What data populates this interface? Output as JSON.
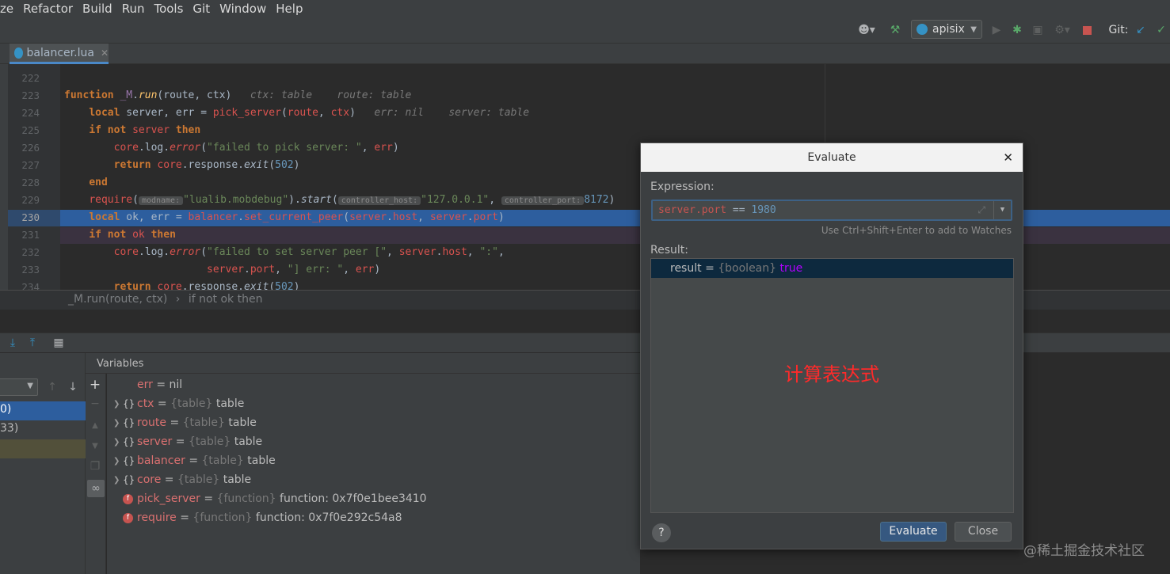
{
  "menu": [
    "ze",
    "Refactor",
    "Build",
    "Run",
    "Tools",
    "Git",
    "Window",
    "Help"
  ],
  "toolbar": {
    "run_config": "apisix",
    "git_label": "Git:"
  },
  "tab": {
    "file_name": "balancer.lua"
  },
  "editor": {
    "lines": [
      {
        "num": "222"
      },
      {
        "num": "223"
      },
      {
        "num": "224"
      },
      {
        "num": "225"
      },
      {
        "num": "226"
      },
      {
        "num": "227"
      },
      {
        "num": "228"
      },
      {
        "num": "229"
      },
      {
        "num": "230"
      },
      {
        "num": "231"
      },
      {
        "num": "232"
      },
      {
        "num": "233"
      },
      {
        "num": "234"
      }
    ],
    "hints": {
      "ctx": "ctx: table",
      "route": "route: table",
      "err": "err: nil",
      "server": "server: table",
      "modname": "modname:",
      "controller_host": "controller_host:",
      "controller_port": "controller_port:"
    },
    "highlighted_line": "230"
  },
  "breadcrumb": {
    "func": "_M.run(route, ctx)",
    "sep": "›",
    "block": "if not ok then"
  },
  "frames": {
    "items": [
      "0)",
      "33)"
    ]
  },
  "variables": {
    "title": "Variables",
    "items": [
      {
        "name": "err",
        "type": "",
        "value": "nil",
        "expandable": false,
        "kind": "plain"
      },
      {
        "name": "ctx",
        "type": "{table}",
        "value": "table",
        "expandable": true,
        "kind": "table"
      },
      {
        "name": "route",
        "type": "{table}",
        "value": "table",
        "expandable": true,
        "kind": "table"
      },
      {
        "name": "server",
        "type": "{table}",
        "value": "table",
        "expandable": true,
        "kind": "table"
      },
      {
        "name": "balancer",
        "type": "{table}",
        "value": "table",
        "expandable": true,
        "kind": "table"
      },
      {
        "name": "core",
        "type": "{table}",
        "value": "table",
        "expandable": true,
        "kind": "table"
      },
      {
        "name": "pick_server",
        "type": "{function}",
        "value": "function: 0x7f0e1bee3410",
        "expandable": false,
        "kind": "function"
      },
      {
        "name": "require",
        "type": "{function}",
        "value": "function: 0x7f0e292c54a8",
        "expandable": false,
        "kind": "function"
      }
    ]
  },
  "dialog": {
    "title": "Evaluate",
    "expression_label": "Expression:",
    "expression_lhs": "server.port",
    "expression_op": "==",
    "expression_rhs": "1980",
    "hint": "Use Ctrl+Shift+Enter to add to Watches",
    "result_label": "Result:",
    "result_name": "result",
    "result_eq": "=",
    "result_type": "{boolean}",
    "result_value": "true",
    "annotation": "计算表达式",
    "help": "?",
    "evaluate_button": "Evaluate",
    "close_button": "Close"
  },
  "watermark": "@稀土掘金技术社区",
  "colors": {
    "accent": "#2d5e9e",
    "annotation": "#ff2a2a",
    "keyword": "#cc7832",
    "string": "#6a8759"
  }
}
